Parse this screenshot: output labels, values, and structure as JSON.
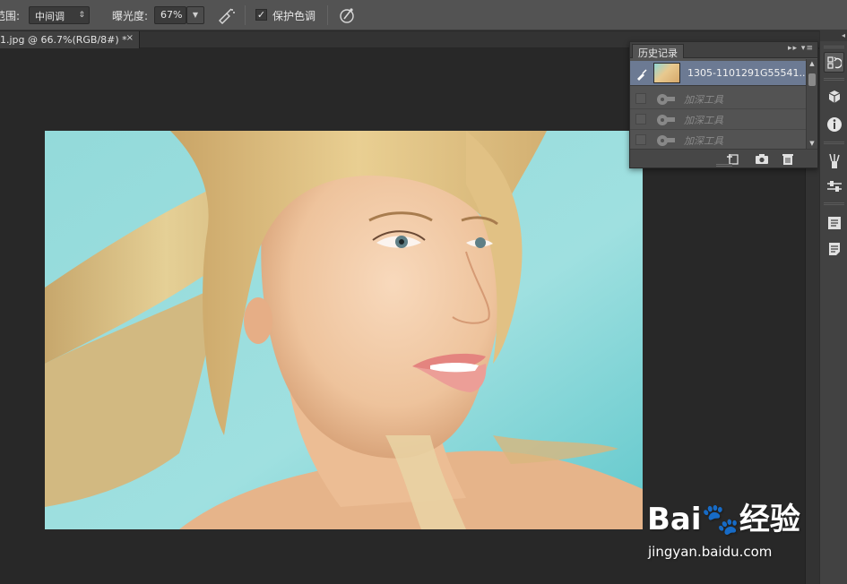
{
  "options_bar": {
    "range_label": "范围:",
    "range_value": "中间调",
    "exposure_label": "曝光度:",
    "exposure_value": "67%",
    "protect_tones_label": "保护色调",
    "protect_tones_checked": true
  },
  "document_tab": {
    "title": "1.jpg @ 66.7%(RGB/8#) *",
    "close_glyph": "×"
  },
  "history_panel": {
    "tab_label": "历史记录",
    "snapshot_name": "1305-1101291G55541...",
    "steps": [
      {
        "label": "加深工具"
      },
      {
        "label": "加深工具"
      },
      {
        "label": "加深工具"
      }
    ]
  },
  "right_dock_icons": [
    "history-icon",
    "3d-cube-icon",
    "info-icon",
    "brush-presets-icon",
    "adjustments-icon",
    "paragraph-styles-icon",
    "notes-icon"
  ],
  "watermark": {
    "logo_text": "Bai🐾经验",
    "url": "jingyan.baidu.com"
  },
  "colors": {
    "ui_panel": "#535353",
    "canvas_bg": "#282828",
    "photo_bg": "#8fd6d6",
    "history_selected": "#6c7a93"
  }
}
